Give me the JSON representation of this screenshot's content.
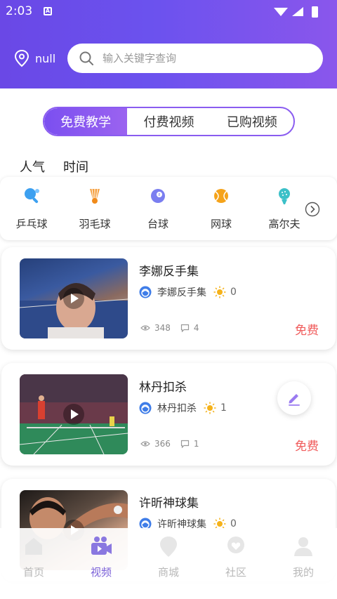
{
  "status_bar": {
    "time": "2:03"
  },
  "header": {
    "location": "null",
    "search_placeholder": "输入关键字查询"
  },
  "segments": [
    {
      "label": "免费教学",
      "active": true
    },
    {
      "label": "付费视频",
      "active": false
    },
    {
      "label": "已购视频",
      "active": false
    }
  ],
  "sort_tabs": [
    {
      "label": "人气",
      "active": true
    },
    {
      "label": "时间",
      "active": false
    }
  ],
  "categories": [
    {
      "label": "乒乓球",
      "icon": "pingpong-icon"
    },
    {
      "label": "羽毛球",
      "icon": "shuttlecock-icon"
    },
    {
      "label": "台球",
      "icon": "billiard-icon"
    },
    {
      "label": "网球",
      "icon": "tennis-icon"
    },
    {
      "label": "高尔夫",
      "icon": "golf-icon"
    }
  ],
  "videos": [
    {
      "title": "李娜反手集",
      "author": "李娜反手集",
      "likes": "0",
      "views": "348",
      "comments": "4",
      "price": "免费"
    },
    {
      "title": "林丹扣杀",
      "author": "林丹扣杀",
      "likes": "1",
      "views": "366",
      "comments": "1",
      "price": "免费"
    },
    {
      "title": "许昕神球集",
      "author": "许昕神球集",
      "likes": "0",
      "views": "",
      "comments": "",
      "price": ""
    }
  ],
  "tabbar": [
    {
      "label": "首页",
      "active": false
    },
    {
      "label": "视频",
      "active": true
    },
    {
      "label": "商城",
      "active": false
    },
    {
      "label": "社区",
      "active": false
    },
    {
      "label": "我的",
      "active": false
    }
  ],
  "colors": {
    "header_gradient_start": "#6a48e6",
    "header_gradient_end": "#8a56ec",
    "accent": "#7b4ff0",
    "price": "#f05a5a",
    "tab_active": "#7b61d8"
  }
}
